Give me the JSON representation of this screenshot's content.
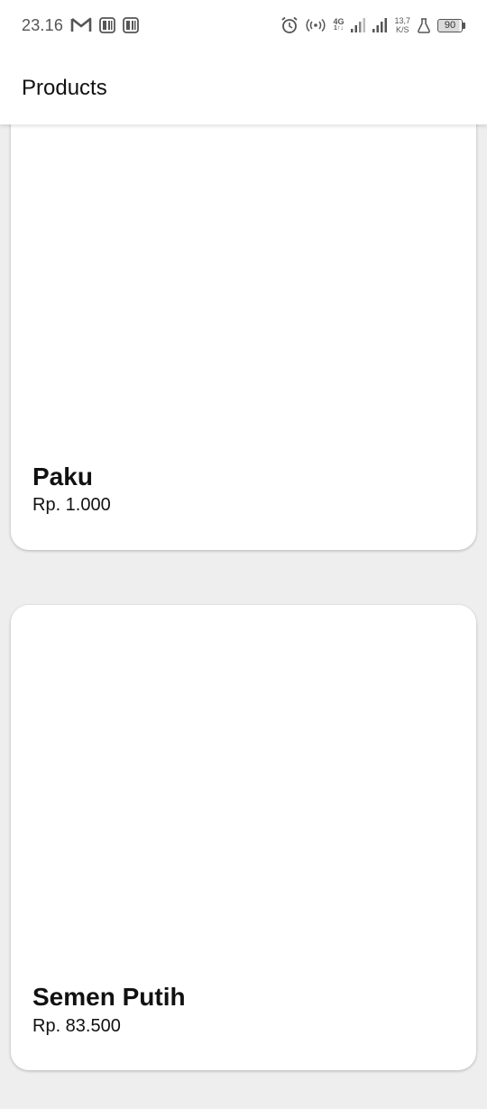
{
  "status_bar": {
    "time": "23.16",
    "network_type_top": "4G",
    "network_type_bottom": "1↑↓",
    "speed_value": "13,7",
    "speed_unit": "K/S",
    "battery_level": "90",
    "icons": [
      "gmail-icon",
      "notification-app-icon",
      "notification-app-icon",
      "alarm-icon",
      "hotspot-icon",
      "signal-icon",
      "signal-icon",
      "flask-icon",
      "battery-icon"
    ]
  },
  "app_bar": {
    "title": "Products"
  },
  "products": [
    {
      "name": "Paku",
      "price": "Rp. 1.000"
    },
    {
      "name": "Semen Putih",
      "price": "Rp. 83.500"
    }
  ],
  "colors": {
    "background": "#eeeeee",
    "surface": "#ffffff",
    "text_primary": "#111111",
    "status_icon": "#555555"
  }
}
